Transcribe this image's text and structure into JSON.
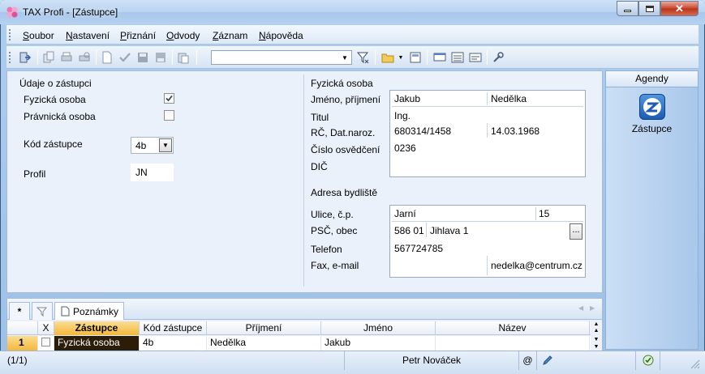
{
  "window": {
    "title": "TAX Profi - [Zástupce]",
    "controls": {
      "minimize": "–",
      "maximize": "□",
      "close": "✕"
    }
  },
  "menu": [
    {
      "key": "S",
      "rest": "oubor"
    },
    {
      "key": "N",
      "rest": "astavení"
    },
    {
      "key": "P",
      "rest": "řiznání"
    },
    {
      "key": "O",
      "rest": "dvody"
    },
    {
      "key": "Z",
      "rest": "áznam"
    },
    {
      "key": "N",
      "rest": "ápověda"
    }
  ],
  "toolbar": {
    "combo_value": "",
    "icons": [
      "exit-icon",
      "copy-icon",
      "print-icon",
      "print-preview-icon",
      "new-icon",
      "check-icon",
      "save-icon",
      "save-as-icon",
      "paste-icon",
      "filter-icon",
      "folder-icon",
      "calculator-icon",
      "form-icon",
      "list-icon",
      "report-icon",
      "settings-icon"
    ]
  },
  "left_group": {
    "title": "Údaje o zástupci",
    "fyzicka_label": "Fyzická osoba",
    "fyzicka_checked": true,
    "pravnicka_label": "Právnická osoba",
    "pravnicka_checked": false,
    "kod_label": "Kód zástupce",
    "kod_value": "4b",
    "profil_label": "Profil",
    "profil_value": "JN"
  },
  "person": {
    "title": "Fyzická osoba",
    "labels": {
      "name": "Jméno, příjmení",
      "titul": "Titul",
      "rc": "RČ, Dat.naroz.",
      "cislo": "Číslo osvědčení",
      "dic": "DIČ"
    },
    "values": {
      "jmeno": "Jakub",
      "prijmeni": "Nedělka",
      "titul": "Ing.",
      "rc": "680314/1458",
      "datum": "14.03.1968",
      "cislo": "0236",
      "dic": ""
    }
  },
  "address": {
    "title": "Adresa bydliště",
    "labels": {
      "ulice": "Ulice, č.p.",
      "psc": "PSČ, obec",
      "telefon": "Telefon",
      "fax": "Fax, e-mail"
    },
    "values": {
      "ulice": "Jarní",
      "cp": "15",
      "psc": "586 01",
      "obec": "Jihlava 1",
      "telefon": "567724785",
      "fax": "",
      "email": "nedelka@centrum.cz"
    },
    "browse": "..."
  },
  "agenda": {
    "header": "Agendy",
    "item": "Zástupce"
  },
  "bottom_tabs": {
    "new": "*",
    "notes": "Poznámky"
  },
  "grid": {
    "headers": [
      "X",
      "Zástupce",
      "Kód zástupce",
      "Příjmení",
      "Jméno",
      "Název"
    ],
    "row": {
      "num": "1",
      "x": "",
      "zastupce": "Fyzická osoba",
      "kod": "4b",
      "prijmeni": "Nedělka",
      "jmeno": "Jakub",
      "nazev": ""
    }
  },
  "status": {
    "record": "(1/1)",
    "user": "Petr Nováček",
    "at": "@"
  },
  "colors": {
    "accent": "#e8b54a",
    "selected_cell": "#2b1d07"
  }
}
